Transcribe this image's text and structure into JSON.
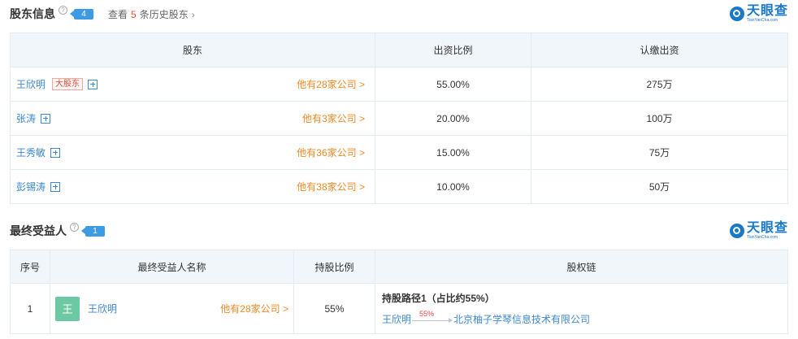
{
  "shareholders_section": {
    "title": "股东信息",
    "count": "4",
    "history_prefix": "查看",
    "history_count": "5",
    "history_suffix": "条历史股东",
    "columns": [
      "股东",
      "出资比例",
      "认缴出资"
    ],
    "rows": [
      {
        "name": "王欣明",
        "tag": "大股东",
        "companies": "他有28家公司 >",
        "ratio": "55.00%",
        "capital": "275万"
      },
      {
        "name": "张涛",
        "tag": "",
        "companies": "他有3家公司 >",
        "ratio": "20.00%",
        "capital": "100万"
      },
      {
        "name": "王秀敏",
        "tag": "",
        "companies": "他有36家公司 >",
        "ratio": "15.00%",
        "capital": "75万"
      },
      {
        "name": "彭锡涛",
        "tag": "",
        "companies": "他有38家公司 >",
        "ratio": "10.00%",
        "capital": "50万"
      }
    ]
  },
  "beneficiary_section": {
    "title": "最终受益人",
    "count": "1",
    "columns": [
      "序号",
      "最终受益人名称",
      "持股比例",
      "股权链"
    ],
    "rows": [
      {
        "index": "1",
        "avatar": "王",
        "name": "王欣明",
        "companies": "他有28家公司 >",
        "ratio": "55%",
        "path_title": "持股路径1（占比约55%）",
        "path_from": "王欣明",
        "path_pct": "55%",
        "path_to": "北京柚子学琴信息技术有限公司"
      }
    ]
  },
  "logo": {
    "text_cn": "天眼查",
    "text_en": "TianYanCha.com"
  },
  "help_glyph": "?",
  "colors": {
    "link_blue": "#3c89d0",
    "orange": "#f08a24",
    "red": "#e64c3b",
    "badge_blue": "#3c9be3",
    "header_bg": "#f1f6fb"
  }
}
